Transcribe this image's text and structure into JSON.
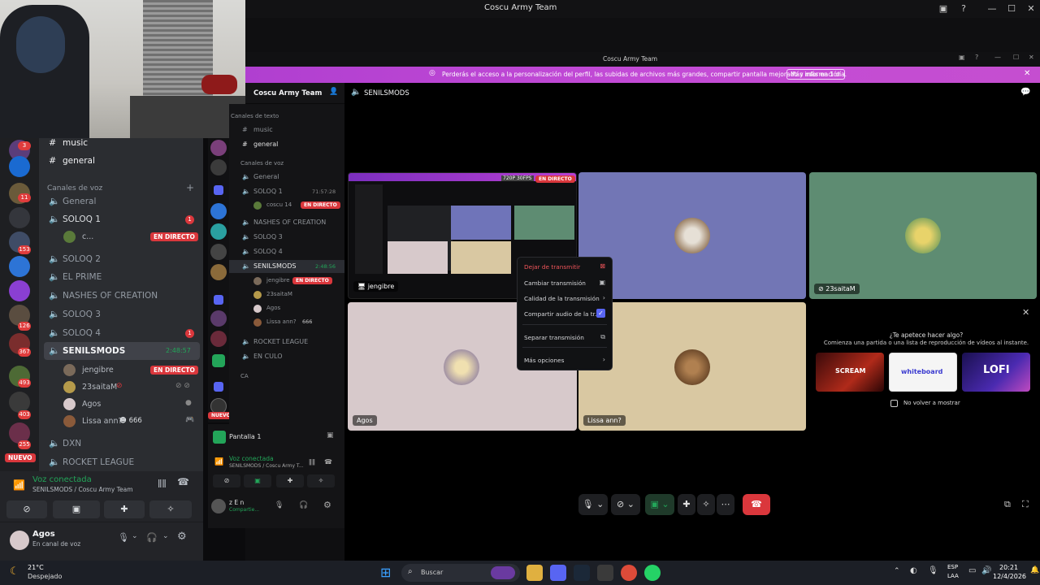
{
  "window": {
    "title": "Coscu Army Team"
  },
  "left_server_badges": [
    "3",
    "11",
    "153",
    "126",
    "367",
    "493",
    "403",
    "255"
  ],
  "left_new_label": "NUEVO",
  "left_channels": {
    "text": [
      {
        "label": "music"
      },
      {
        "label": "general"
      }
    ],
    "voice_header": "Canales de voz",
    "voice": [
      {
        "label": "General"
      },
      {
        "label": "SOLOQ 1",
        "count": "1"
      },
      {
        "label": "SOLOQ 2"
      },
      {
        "label": "EL PRIME"
      },
      {
        "label": "NASHES OF CREATION"
      },
      {
        "label": "SOLOQ 3"
      },
      {
        "label": "SOLOQ 4",
        "count": "1"
      },
      {
        "label": "SENILSMODS",
        "time": "2:48:57"
      },
      {
        "label": "DXN"
      },
      {
        "label": "ROCKET LEAGUE"
      }
    ],
    "soloq1_user": "c...",
    "live_label": "EN DIRECTO",
    "senils_users": [
      {
        "name": "jengibre",
        "live": true
      },
      {
        "name": "23saitaM"
      },
      {
        "name": "Agos"
      },
      {
        "name": "Lissa ann?",
        "extra": "666"
      }
    ]
  },
  "left_voice": {
    "status": "Voz conectada",
    "where": "SENILSMODS / Coscu Army Team"
  },
  "left_user": {
    "name": "Agos",
    "status": "En canal de voz"
  },
  "inner": {
    "window_title": "Coscu Army Team",
    "banner_text": "Perderás el acceso a la personalización del perfil, las subidas de archivos más grandes, compartir pantalla mejorado y más en 1 día.",
    "banner_button": "Más información",
    "server_name": "Coscu Army Team",
    "channel_name": "SENILSMODS",
    "channels": [
      {
        "label": "Canales de texto",
        "kind": "header"
      },
      {
        "label": "music",
        "kind": "text"
      },
      {
        "label": "general",
        "kind": "text"
      },
      {
        "label": "Canales de voz",
        "kind": "header"
      },
      {
        "label": "General",
        "kind": "voice"
      },
      {
        "label": "SOLOQ 1",
        "kind": "voice",
        "time": "71:57:28"
      },
      {
        "label": "coscu 14",
        "kind": "user",
        "live": true
      },
      {
        "label": "NASHES OF CREATION",
        "kind": "voice"
      },
      {
        "label": "SOLOQ 3",
        "kind": "voice"
      },
      {
        "label": "SOLOQ 4",
        "kind": "voice"
      },
      {
        "label": "SENILSMODS",
        "kind": "voice",
        "time": "2:48:56",
        "active": true
      },
      {
        "label": "jengibre",
        "kind": "user",
        "live": true
      },
      {
        "label": "23saitaM",
        "kind": "user"
      },
      {
        "label": "Agos",
        "kind": "user"
      },
      {
        "label": "Lissa ann?",
        "kind": "user",
        "extra": "666"
      },
      {
        "label": "ROCKET LEAGUE",
        "kind": "voice"
      },
      {
        "label": "EN CULO",
        "kind": "voice"
      },
      {
        "label": "CA",
        "kind": "header"
      }
    ],
    "stream_label": "Pantalla 1",
    "voice_status": "Voz conectada",
    "voice_where": "SENILSMODS / Coscu Army T...",
    "user_name": "z E n",
    "user_status": "Compartie...",
    "new_label": "NUEVO"
  },
  "stream": {
    "quality": "720P 30FPS",
    "live_label": "EN DIRECTO",
    "streamer": "jengibre"
  },
  "tiles": [
    {
      "name": "23saitaM",
      "color": "#5e8c72"
    },
    {
      "name": "Agos",
      "color": "#d7c9cb"
    },
    {
      "name": "Lissa ann?",
      "color": "#d9c8a2"
    }
  ],
  "third_tile_color": "#7276b5",
  "context_menu": [
    {
      "label": "Dejar de transmitir",
      "danger": true
    },
    {
      "label": "Cambiar transmisión"
    },
    {
      "label": "Calidad de la transmisión",
      "arrow": true
    },
    {
      "label": "Compartir audio de la tr...",
      "checked": true
    },
    {
      "label": "Separar transmisión"
    },
    {
      "label": "Más opciones",
      "arrow": true
    }
  ],
  "suggest": {
    "title": "¿Te apetece hacer algo?",
    "subtitle": "Comienza una partida o una lista de reproducción de vídeos al instante.",
    "checkbox_label": "No volver a mostrar",
    "games": [
      "SCREAM",
      "whiteboard",
      "LOFI"
    ]
  },
  "taskbar": {
    "weather_temp": "21°C",
    "weather_desc": "Despejado",
    "search_placeholder": "Buscar",
    "lang_top": "ESP",
    "lang_bottom": "LAA",
    "time": "20:21",
    "date": "12/4/2026"
  },
  "colors": {
    "accent_live": "#da373c",
    "voice_green": "#23a559",
    "banner": "#b83fd2",
    "blurple": "#5865f2"
  }
}
